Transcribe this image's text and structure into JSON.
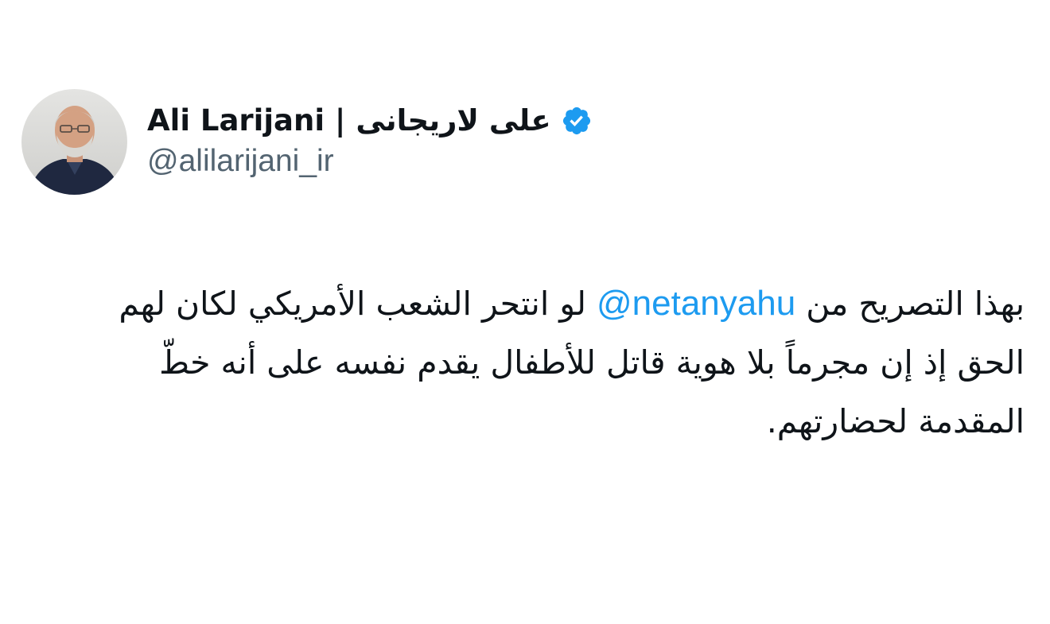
{
  "tweet": {
    "author": {
      "display_name": "Ali Larijani | على لاريجانى",
      "handle": "@alilarijani_ir",
      "verified": true,
      "avatar_icon": "profile-photo-icon",
      "verified_icon": "verified-badge-icon"
    },
    "text_before_mention": "بهذا التصريح من",
    "mention": "@netanyahu",
    "text_after_mention": "لو انتحر الشعب الأمريكي لكان لهم الحق إذ إن مجرماً بلا هوية قاتل للأطفال يقدم نفسه على أنه خطّ المقدمة لحضارتهم."
  },
  "colors": {
    "primary_text": "#0f1419",
    "secondary_text": "#536471",
    "link": "#1d9bf0",
    "verified": "#1d9bf0",
    "background": "#ffffff"
  }
}
